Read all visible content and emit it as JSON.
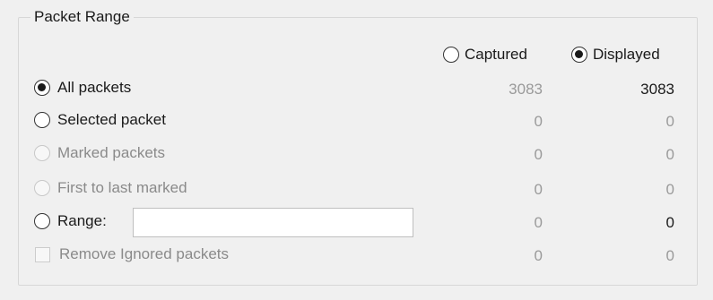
{
  "group": {
    "title": "Packet Range"
  },
  "columns": {
    "captured": {
      "label": "Captured",
      "checked": false
    },
    "displayed": {
      "label": "Displayed",
      "checked": true
    }
  },
  "rows": [
    {
      "label": "All packets",
      "checked": true,
      "enabled": true,
      "captured": "3083",
      "displayed": "3083"
    },
    {
      "label": "Selected packet",
      "checked": false,
      "enabled": true,
      "captured": "0",
      "displayed": "0"
    },
    {
      "label": "Marked packets",
      "checked": false,
      "enabled": false,
      "captured": "0",
      "displayed": "0"
    },
    {
      "label": "First to last marked",
      "checked": false,
      "enabled": false,
      "captured": "0",
      "displayed": "0"
    },
    {
      "label": "Range:",
      "checked": false,
      "enabled": true,
      "captured": "0",
      "displayed": "0",
      "input_value": ""
    },
    {
      "label": "Remove Ignored packets",
      "checked": false,
      "enabled": false,
      "captured": "0",
      "displayed": "0"
    }
  ]
}
